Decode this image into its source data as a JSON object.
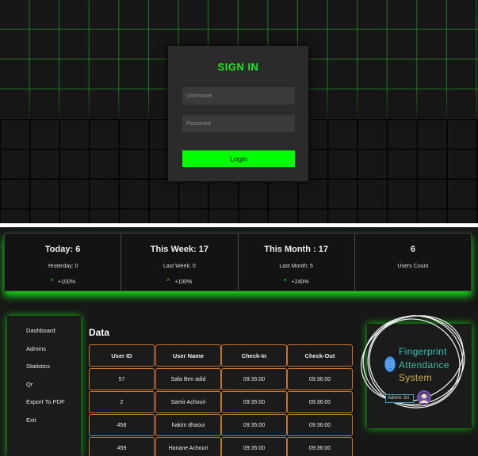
{
  "signin": {
    "title": "SIGN IN",
    "username_placeholder": "Username",
    "password_placeholder": "Password",
    "login_label": "Login"
  },
  "stats": [
    {
      "title": "Today: 6",
      "sub": "Yesterday: 0",
      "delta": "+100%"
    },
    {
      "title": "This Week: 17",
      "sub": "Last Week: 0",
      "delta": "+100%"
    },
    {
      "title": "This Month : 17",
      "sub": "Last Month: 5",
      "delta": "+240%"
    },
    {
      "title": "6",
      "sub": "Users Count"
    }
  ],
  "sidebar": {
    "items": [
      "Dashboard",
      "Admins",
      "Statistics",
      "Qr",
      "Export To PDF",
      "Exit"
    ]
  },
  "data": {
    "title": "Data",
    "columns": [
      "User ID",
      "User Name",
      "Check-In",
      "Check-Out"
    ],
    "rows": [
      [
        "57",
        "Safa Ben adid",
        "09:35:00",
        "09:36:00"
      ],
      [
        "2",
        "Samir Achouri",
        "09:35:00",
        "09:36:00"
      ],
      [
        "458",
        "hakim dhaoui",
        "09:35:00",
        "09:36:00"
      ],
      [
        "459",
        "Hanane Achouri",
        "09:35:00",
        "09:36:00"
      ]
    ]
  },
  "brand": {
    "line1": "Fingerprint",
    "line2": "Attendance",
    "line3": "System",
    "admin_value": "Admin: bri",
    "colors": {
      "line1": "#2ec4b6",
      "line2": "#3fb8a0",
      "line3": "#d4b24a"
    }
  },
  "colors": {
    "accent": "#00ff00",
    "panel_bg": "#2b2b2b",
    "table_border": "#c8752a"
  }
}
